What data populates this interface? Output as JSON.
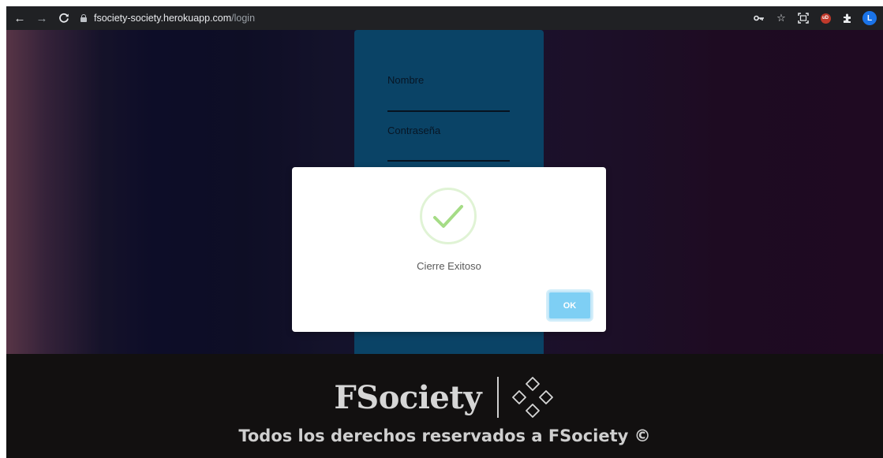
{
  "browser": {
    "url_host": "fsociety-society.herokuapp.com",
    "url_path": "/login",
    "profile_initial": "L",
    "ublock_label": "uD",
    "icons": [
      "back-arrow-icon",
      "forward-arrow-icon",
      "reload-icon",
      "lock-icon",
      "key-icon",
      "star-icon",
      "screenshot-icon",
      "ublock-icon",
      "extensions-icon",
      "profile-avatar"
    ]
  },
  "login_form": {
    "name_label": "Nombre",
    "password_label": "Contraseña"
  },
  "modal": {
    "icon": "success-check-icon",
    "title": "Cierre Exitoso",
    "ok_label": "OK"
  },
  "footer": {
    "brand": "FSociety",
    "copyright": "Todos los derechos reservados a FSociety ©"
  },
  "colors": {
    "toolbar_bg": "#202124",
    "login_card": "#0f5e8e",
    "check_green": "#a5dc86",
    "ok_button": "#7ecff4",
    "footer_bg": "#121010"
  }
}
